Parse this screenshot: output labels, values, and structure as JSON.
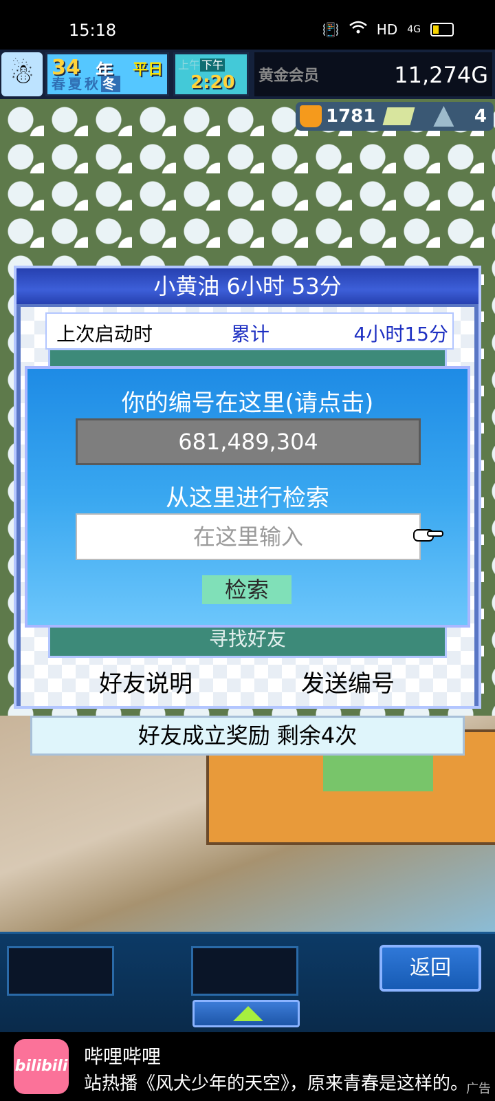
{
  "status_bar": {
    "time": "15:18",
    "network": "HD",
    "signal": "4G"
  },
  "hud": {
    "year_number": "34",
    "year_unit": "年",
    "weekday": "平日",
    "seasons": [
      "春",
      "夏",
      "秋",
      "冬"
    ],
    "current_season": "冬",
    "am_label": "上午",
    "pm_label": "下午",
    "time": "2:20",
    "member_rank": "黄金会员",
    "money": "11,274G",
    "research_points": "1781",
    "tree_count": "4"
  },
  "panel": {
    "title": "小黄油  6小时 53分",
    "last_launch_label": "上次启动时",
    "total_label": "累计",
    "total_value": "4小时15分",
    "find_friend": "寻找好友",
    "tab_explain": "好友说明",
    "tab_send_id": "发送编号"
  },
  "dialog": {
    "heading": "你的编号在这里(请点击)",
    "player_id": "681,489,304",
    "search_heading": "从这里进行检索",
    "search_placeholder": "在这里输入",
    "search_button": "检索"
  },
  "reward": {
    "text": "好友成立奖励  剩余4次"
  },
  "bottom_bar": {
    "back_label": "返回"
  },
  "ad": {
    "logo_text": "bilibili",
    "title": "哔哩哔哩",
    "description": "站热播《风犬少年的天空》，原来青春是这样的。",
    "tag": "广告"
  },
  "colors": {
    "dialog_blue": "#1e8be5",
    "panel_title_blue": "#2640b0",
    "accent_green": "#80e0b8",
    "money_white": "#ffffff",
    "ad_pink": "#fb7299"
  }
}
